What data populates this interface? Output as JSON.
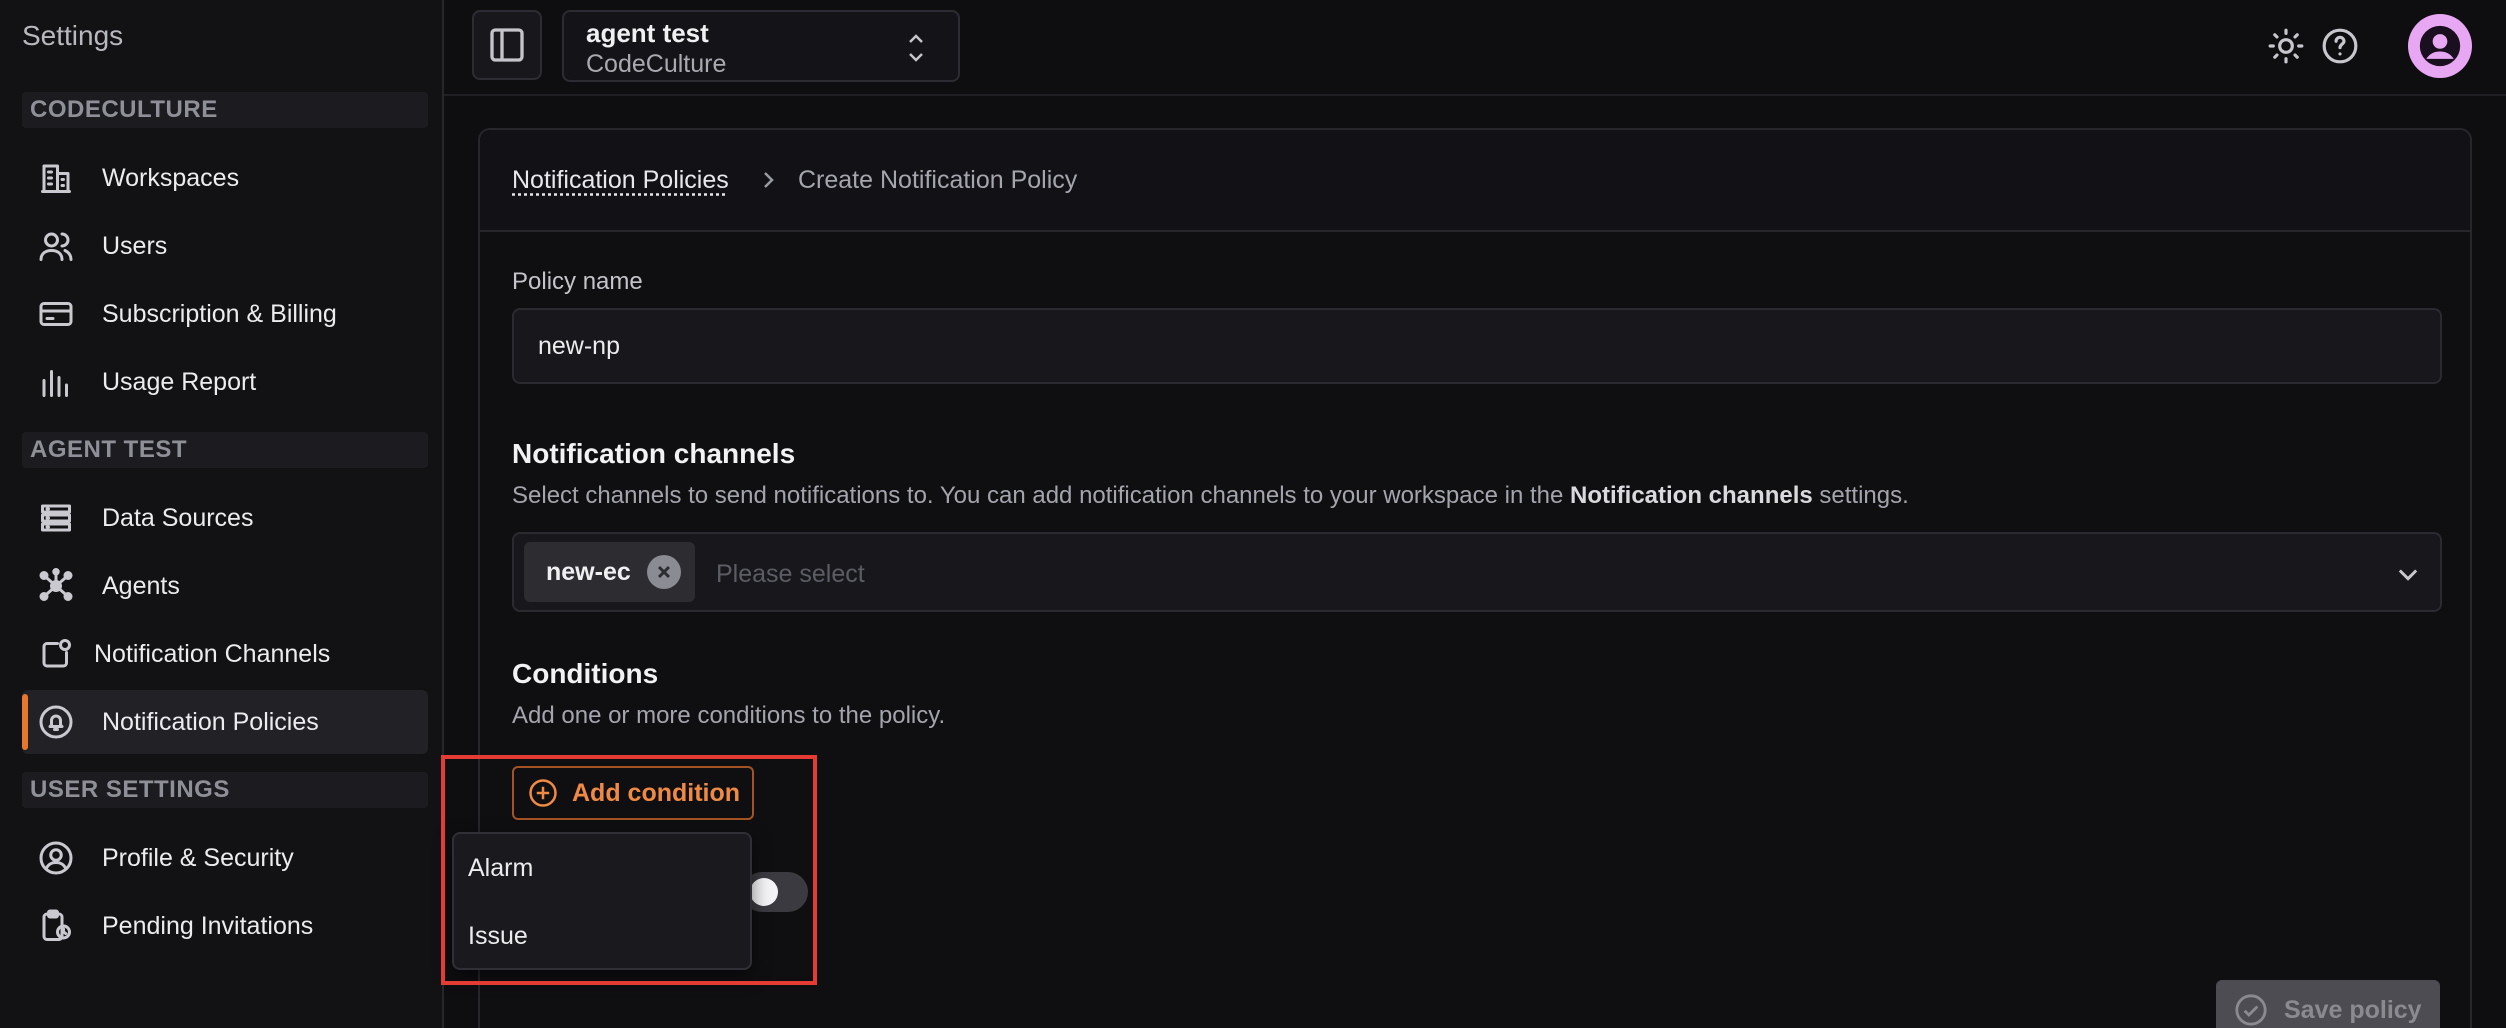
{
  "sidebar": {
    "title": "Settings",
    "sections": [
      {
        "label": "CODECULTURE"
      },
      {
        "label": "AGENT TEST"
      },
      {
        "label": "USER SETTINGS"
      }
    ],
    "items": [
      {
        "label": "Workspaces",
        "icon": "building-icon"
      },
      {
        "label": "Users",
        "icon": "users-icon"
      },
      {
        "label": "Subscription & Billing",
        "icon": "credit-card-icon"
      },
      {
        "label": "Usage Report",
        "icon": "bar-chart-icon"
      },
      {
        "label": "Data Sources",
        "icon": "server-icon"
      },
      {
        "label": "Agents",
        "icon": "network-icon"
      },
      {
        "label": "Notification Channels",
        "icon": "notification-channel-icon"
      },
      {
        "label": "Notification Policies",
        "icon": "bell-shield-icon"
      },
      {
        "label": "Profile & Security",
        "icon": "user-circle-icon"
      },
      {
        "label": "Pending Invitations",
        "icon": "clipboard-clock-icon"
      }
    ]
  },
  "topbar": {
    "workspace_name": "agent test",
    "organization": "CodeCulture"
  },
  "breadcrumb": {
    "parent": "Notification Policies",
    "current": "Create Notification Policy"
  },
  "form": {
    "policy_name_label": "Policy name",
    "policy_name_value": "new-np",
    "channels_heading": "Notification channels",
    "channels_desc_prefix": "Select channels to send notifications to. You can add notification channels to your workspace in the ",
    "channels_desc_bold": "Notification channels",
    "channels_desc_suffix": " settings.",
    "selected_channel": "new-ec",
    "channels_placeholder": "Please select",
    "conditions_heading": "Conditions",
    "conditions_desc": "Add one or more conditions to the policy.",
    "add_condition_label": "Add condition",
    "save_label": "Save policy"
  },
  "condition_menu": {
    "options": [
      "Alarm",
      "Issue"
    ]
  },
  "colors": {
    "accent": "#ee8a44",
    "active_indicator": "#e8762c",
    "highlight": "#e53b35",
    "avatar": "#e8a7f3"
  }
}
